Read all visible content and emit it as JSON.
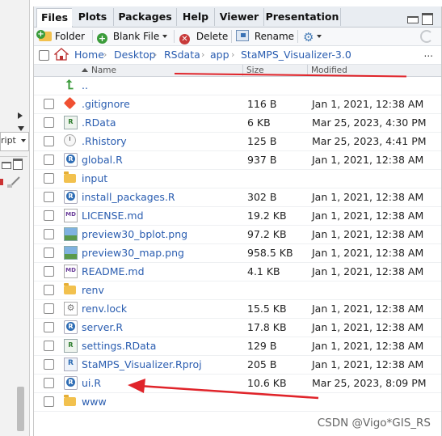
{
  "left_pane": {
    "dropdown_text": "ript"
  },
  "tabs": [
    {
      "label": "Files",
      "active": true
    },
    {
      "label": "Plots"
    },
    {
      "label": "Packages"
    },
    {
      "label": "Help"
    },
    {
      "label": "Viewer"
    },
    {
      "label": "Presentation"
    }
  ],
  "toolbar": {
    "new_folder": "Folder",
    "blank_file": "Blank File",
    "delete": "Delete",
    "rename": "Rename"
  },
  "breadcrumb": [
    "Home",
    "Desktop",
    "RSdata",
    "app",
    "StaMPS_Visualizer-3.0"
  ],
  "pathbar_more": "...",
  "columns": {
    "name": "Name",
    "size": "Size",
    "modified": "Modified"
  },
  "parent_dir": "..",
  "files": [
    {
      "name": ".gitignore",
      "size": "116 B",
      "modified": "Jan 1, 2021, 12:38 AM",
      "icon": "git-icon"
    },
    {
      "name": ".RData",
      "size": "6 KB",
      "modified": "Mar 25, 2023, 4:30 PM",
      "icon": "rdata-icon"
    },
    {
      "name": ".Rhistory",
      "size": "125 B",
      "modified": "Mar 25, 2023, 4:41 PM",
      "icon": "history-icon"
    },
    {
      "name": "global.R",
      "size": "937 B",
      "modified": "Jan 1, 2021, 12:38 AM",
      "icon": "r-file-icon"
    },
    {
      "name": "input",
      "size": "",
      "modified": "",
      "icon": "folder-icon"
    },
    {
      "name": "install_packages.R",
      "size": "302 B",
      "modified": "Jan 1, 2021, 12:38 AM",
      "icon": "r-file-icon"
    },
    {
      "name": "LICENSE.md",
      "size": "19.2 KB",
      "modified": "Jan 1, 2021, 12:38 AM",
      "icon": "markdown-icon"
    },
    {
      "name": "preview30_bplot.png",
      "size": "97.2 KB",
      "modified": "Jan 1, 2021, 12:38 AM",
      "icon": "image-icon"
    },
    {
      "name": "preview30_map.png",
      "size": "958.5 KB",
      "modified": "Jan 1, 2021, 12:38 AM",
      "icon": "image-icon"
    },
    {
      "name": "README.md",
      "size": "4.1 KB",
      "modified": "Jan 1, 2021, 12:38 AM",
      "icon": "markdown-icon"
    },
    {
      "name": "renv",
      "size": "",
      "modified": "",
      "icon": "folder-icon"
    },
    {
      "name": "renv.lock",
      "size": "15.5 KB",
      "modified": "Jan 1, 2021, 12:38 AM",
      "icon": "lock-file-icon"
    },
    {
      "name": "server.R",
      "size": "17.8 KB",
      "modified": "Jan 1, 2021, 12:38 AM",
      "icon": "r-file-icon"
    },
    {
      "name": "settings.RData",
      "size": "129 B",
      "modified": "Jan 1, 2021, 12:38 AM",
      "icon": "rdata-icon"
    },
    {
      "name": "StaMPS_Visualizer.Rproj",
      "size": "205 B",
      "modified": "Jan 1, 2021, 12:38 AM",
      "icon": "rproj-icon"
    },
    {
      "name": "ui.R",
      "size": "10.6 KB",
      "modified": "Mar 25, 2023, 8:09 PM",
      "icon": "r-file-icon"
    },
    {
      "name": "www",
      "size": "",
      "modified": "",
      "icon": "folder-icon"
    }
  ],
  "watermark": "CSDN @Vigo*GIS_RS",
  "colors": {
    "link": "#2a5db0",
    "annotation_red": "#e0242a",
    "folder": "#f2c14e"
  }
}
